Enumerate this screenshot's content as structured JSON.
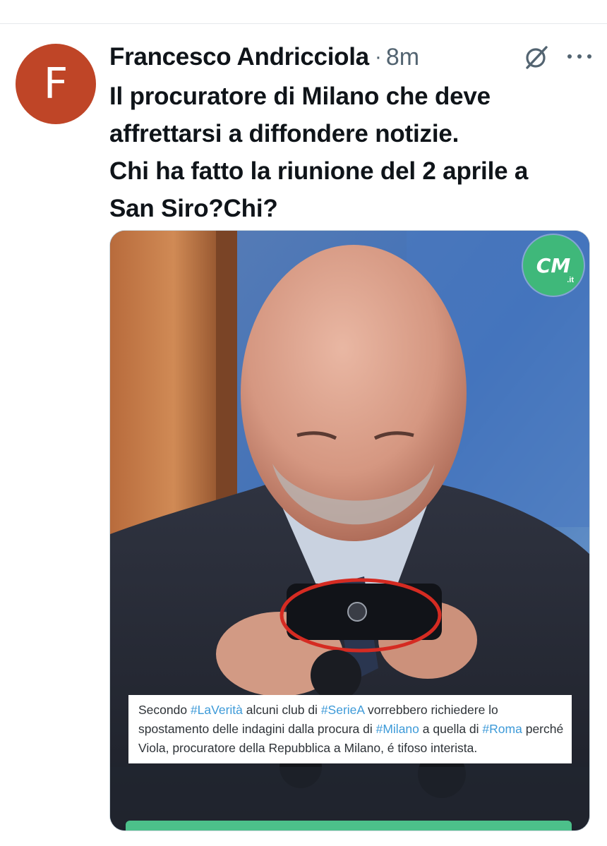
{
  "tweet": {
    "avatar_letter": "F",
    "author": "Francesco Andricciola",
    "separator": "·",
    "time": "8m",
    "text_lines": [
      "Il procuratore di Milano che deve",
      "affrettarsi a diffondere notizie.",
      "Chi ha fatto la riunione del 2 aprile a",
      "San Siro?Chi?"
    ]
  },
  "media": {
    "logo_text": "CM",
    "logo_suffix": ".it",
    "caption": {
      "w1": "Secondo ",
      "tag1": "#LaVerità",
      "w2": " alcuni club di ",
      "tag2": "#SerieA",
      "w3": " vorrebbero richiedere lo spostamento delle indagini dalla procura di ",
      "tag3": "#Milano",
      "w4": " a quella di ",
      "tag4": "#Roma",
      "w5": " perché Viola, procuratore della Repubblica a Milano, é tifoso interista."
    }
  },
  "icons": {
    "grok": "grok-icon",
    "more": "more-icon"
  },
  "colors": {
    "avatar_bg": "#bf4527",
    "hashtag": "#3d9ad8",
    "secondary_text": "#536471",
    "logo_green": "#3fb87a"
  }
}
